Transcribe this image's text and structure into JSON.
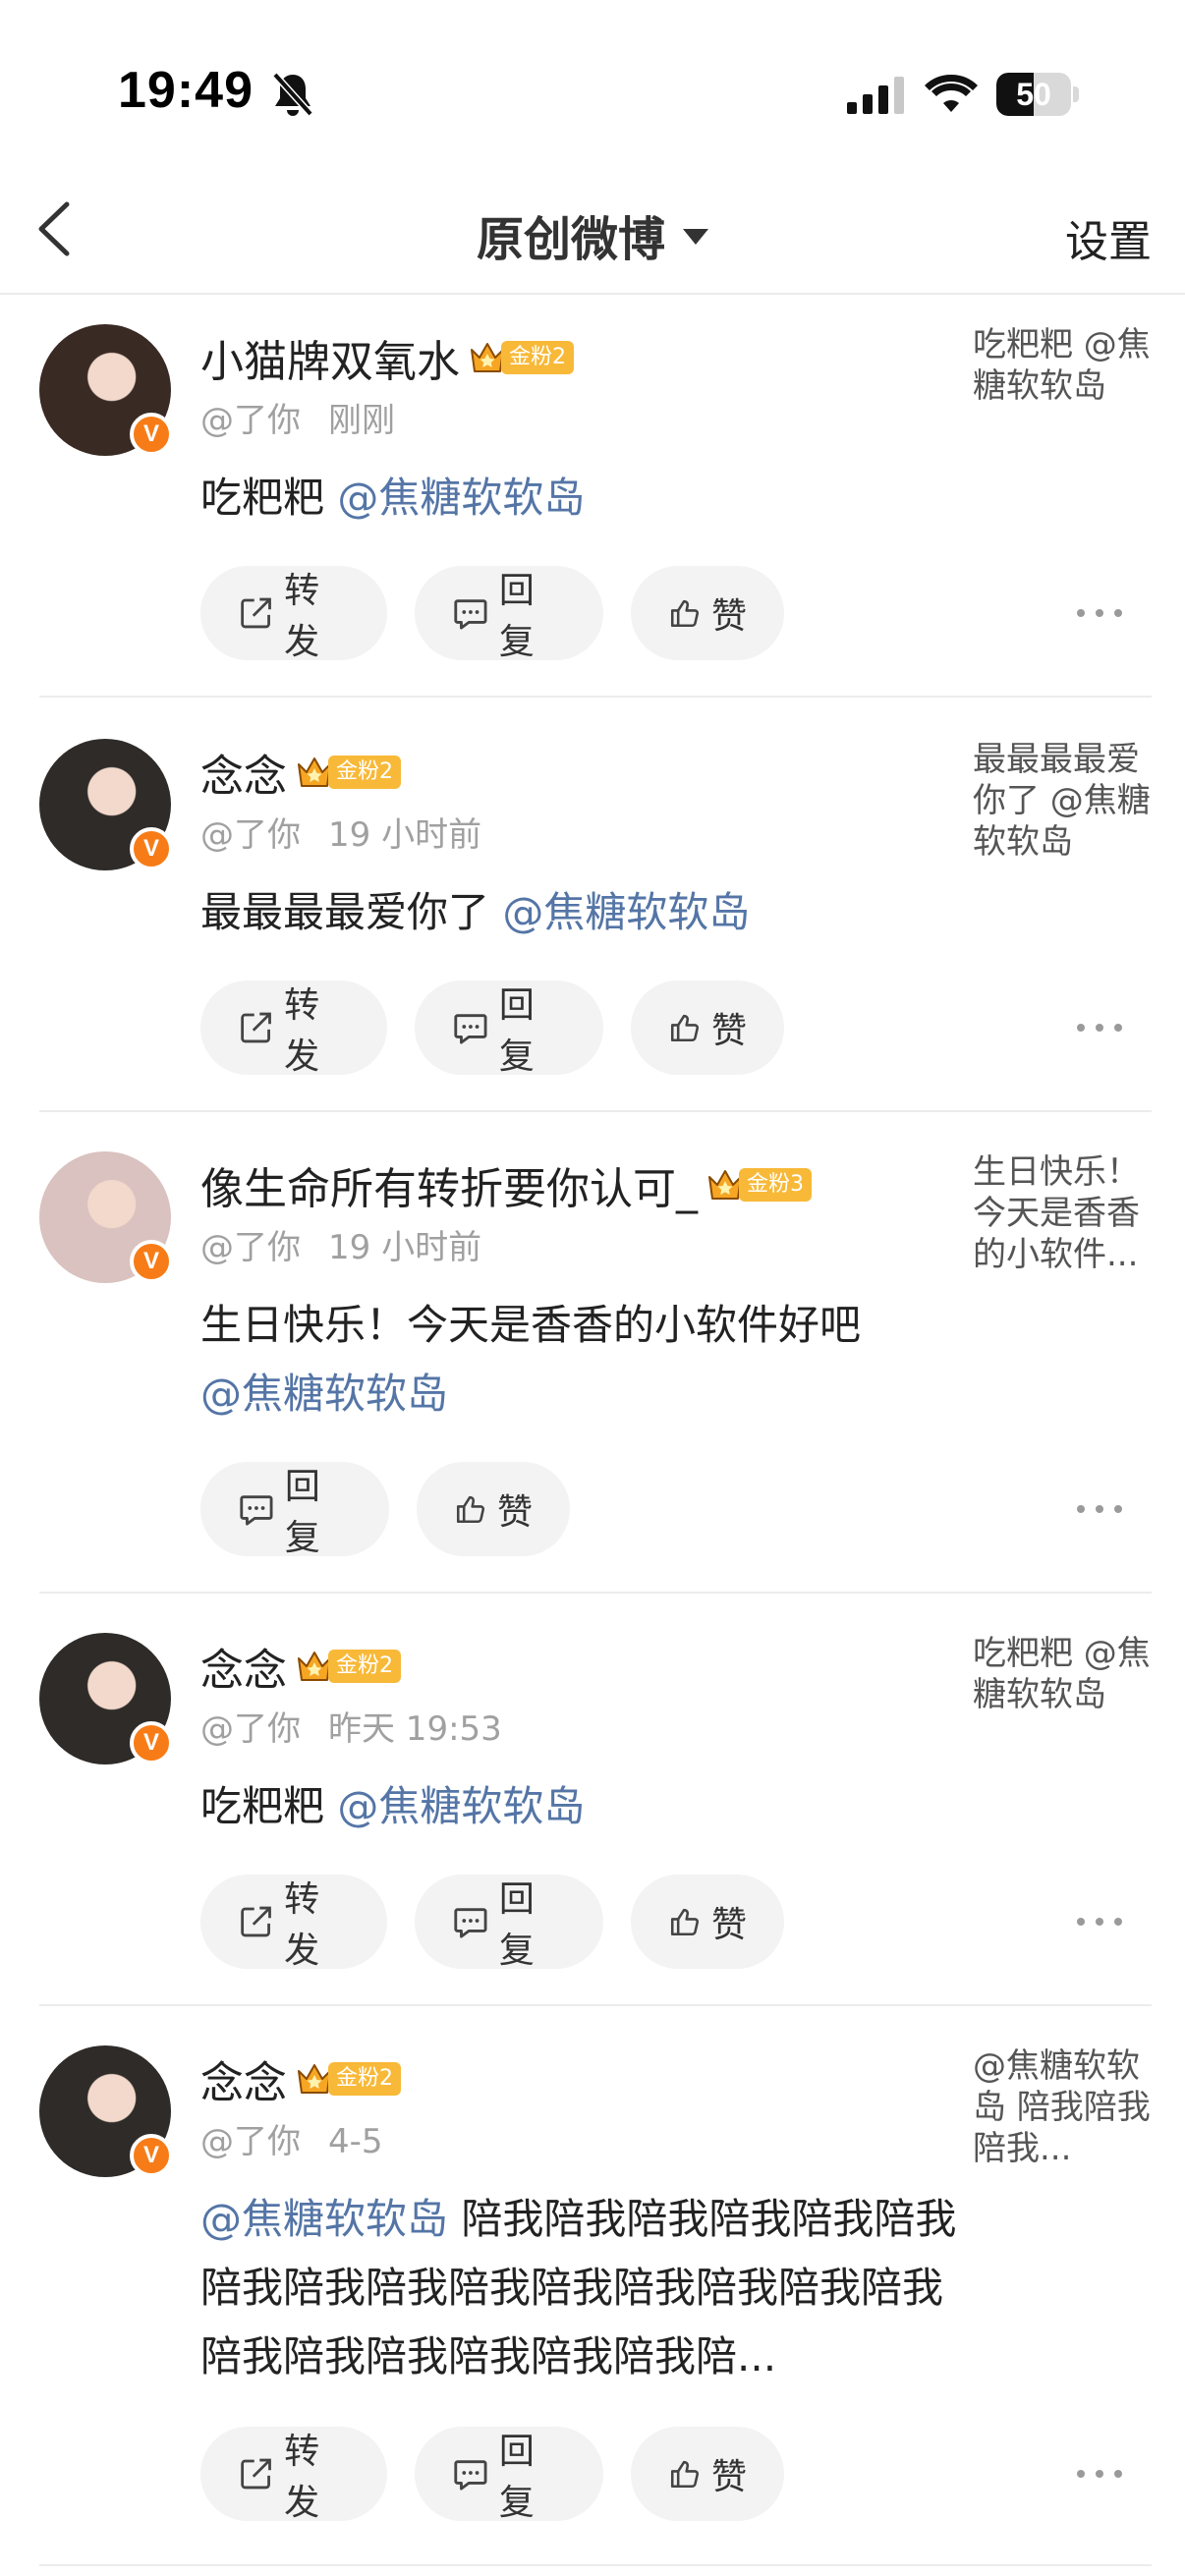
{
  "status_bar": {
    "time": "19:49",
    "battery_pct": "50",
    "battery_level": 0.5
  },
  "nav": {
    "title": "原创微博",
    "settings": "设置"
  },
  "actions": {
    "forward": "转发",
    "reply": "回复",
    "like": "赞"
  },
  "items": [
    {
      "name": "小猫牌双氧水",
      "fan_level": "金粉2",
      "at": "@了你",
      "time": "刚刚",
      "text": "吃粑粑 ",
      "mention": "@焦糖软软岛",
      "quote": "吃粑粑 @焦糖软软岛",
      "avatar_color": "#3a2a24"
    },
    {
      "name": "念念",
      "fan_level": "金粉2",
      "at": "@了你",
      "time": "19 小时前",
      "text": "最最最最爱你了 ",
      "mention": "@焦糖软软岛",
      "quote": "最最最最爱你了 @焦糖软软岛",
      "avatar_color": "#2e2b28"
    },
    {
      "name": "像生命所有转折要你认可_",
      "fan_level": "金粉3",
      "at": "@了你",
      "time": "19 小时前",
      "text": "生日快乐！今天是香香的小软件好吧",
      "mention": "@焦糖软软岛",
      "quote": "生日快乐！今天是香香的小软件...",
      "avatar_color": "#d9c2bf"
    },
    {
      "name": "念念",
      "fan_level": "金粉2",
      "at": "@了你",
      "time": "昨天 19:53",
      "text": "吃粑粑 ",
      "mention": "@焦糖软软岛",
      "quote": "吃粑粑 @焦糖软软岛",
      "avatar_color": "#2e2b28"
    },
    {
      "name": "念念",
      "fan_level": "金粉2",
      "at": "@了你",
      "time": "4-5",
      "mention": "@焦糖软软岛",
      "text": " 陪我陪我陪我陪我陪我陪我陪我陪我陪我陪我陪我陪我陪我陪我陪我陪我陪我陪我陪我陪我陪我陪...",
      "quote": "@焦糖软软岛 陪我陪我陪我...",
      "avatar_color": "#2e2b28"
    }
  ]
}
